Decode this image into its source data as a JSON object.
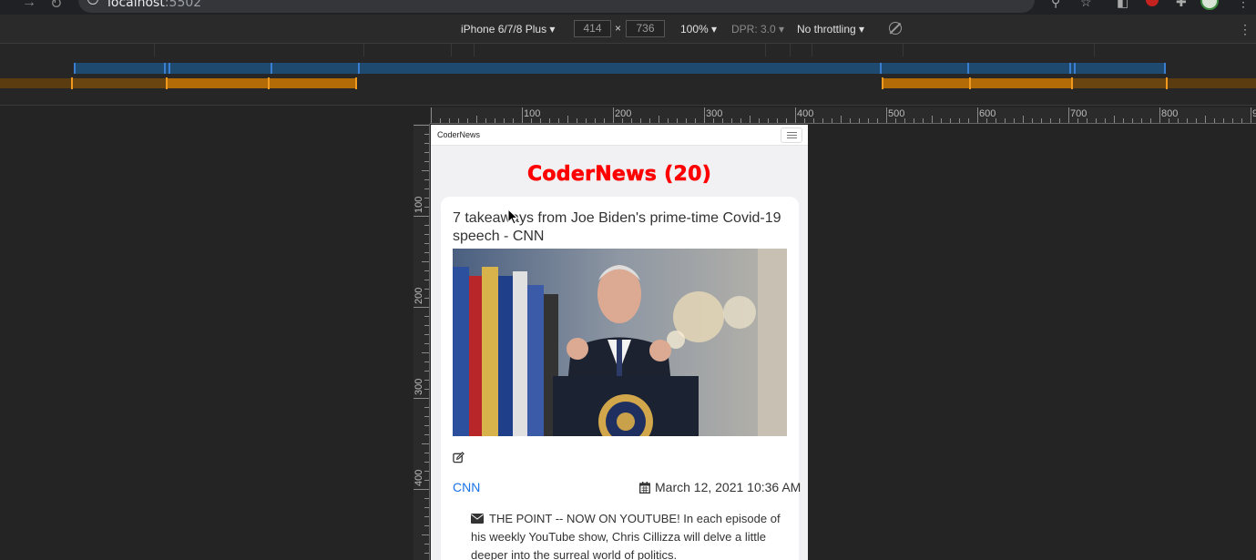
{
  "browser": {
    "url_host": "localhost",
    "url_port": ":5502"
  },
  "device_toolbar": {
    "device": "iPhone 6/7/8 Plus",
    "width": "414",
    "times": "×",
    "height": "736",
    "zoom": "100%",
    "dpr": "DPR: 3.0",
    "throttling": "No throttling"
  },
  "rulers": {
    "horizontal": [
      "100",
      "200",
      "300",
      "400",
      "500",
      "600",
      "700",
      "800",
      "9"
    ],
    "vertical": [
      "100",
      "200",
      "300",
      "400"
    ]
  },
  "app": {
    "brand": "CoderNews",
    "heading": "CoderNews (20)"
  },
  "article": {
    "title": "7 takeaways from Joe Biden's prime-time Covid-19 speech - CNN",
    "source": "CNN",
    "date": "March 12, 2021 10:36 AM",
    "description": "THE POINT -- NOW ON YOUTUBE! In each episode of his weekly YouTube show, Chris Cillizza will delve a little deeper into the surreal world of politics."
  },
  "colors": {
    "heading": "#ff0000",
    "link": "#1a73e8",
    "media_query_max": "#1e4a70",
    "media_query_min": "#b36b08"
  },
  "icons": {
    "edit": "edit-icon",
    "calendar": "calendar-icon",
    "mail": "envelope-icon",
    "menu": "hamburger-icon",
    "rotate": "rotate-icon"
  }
}
